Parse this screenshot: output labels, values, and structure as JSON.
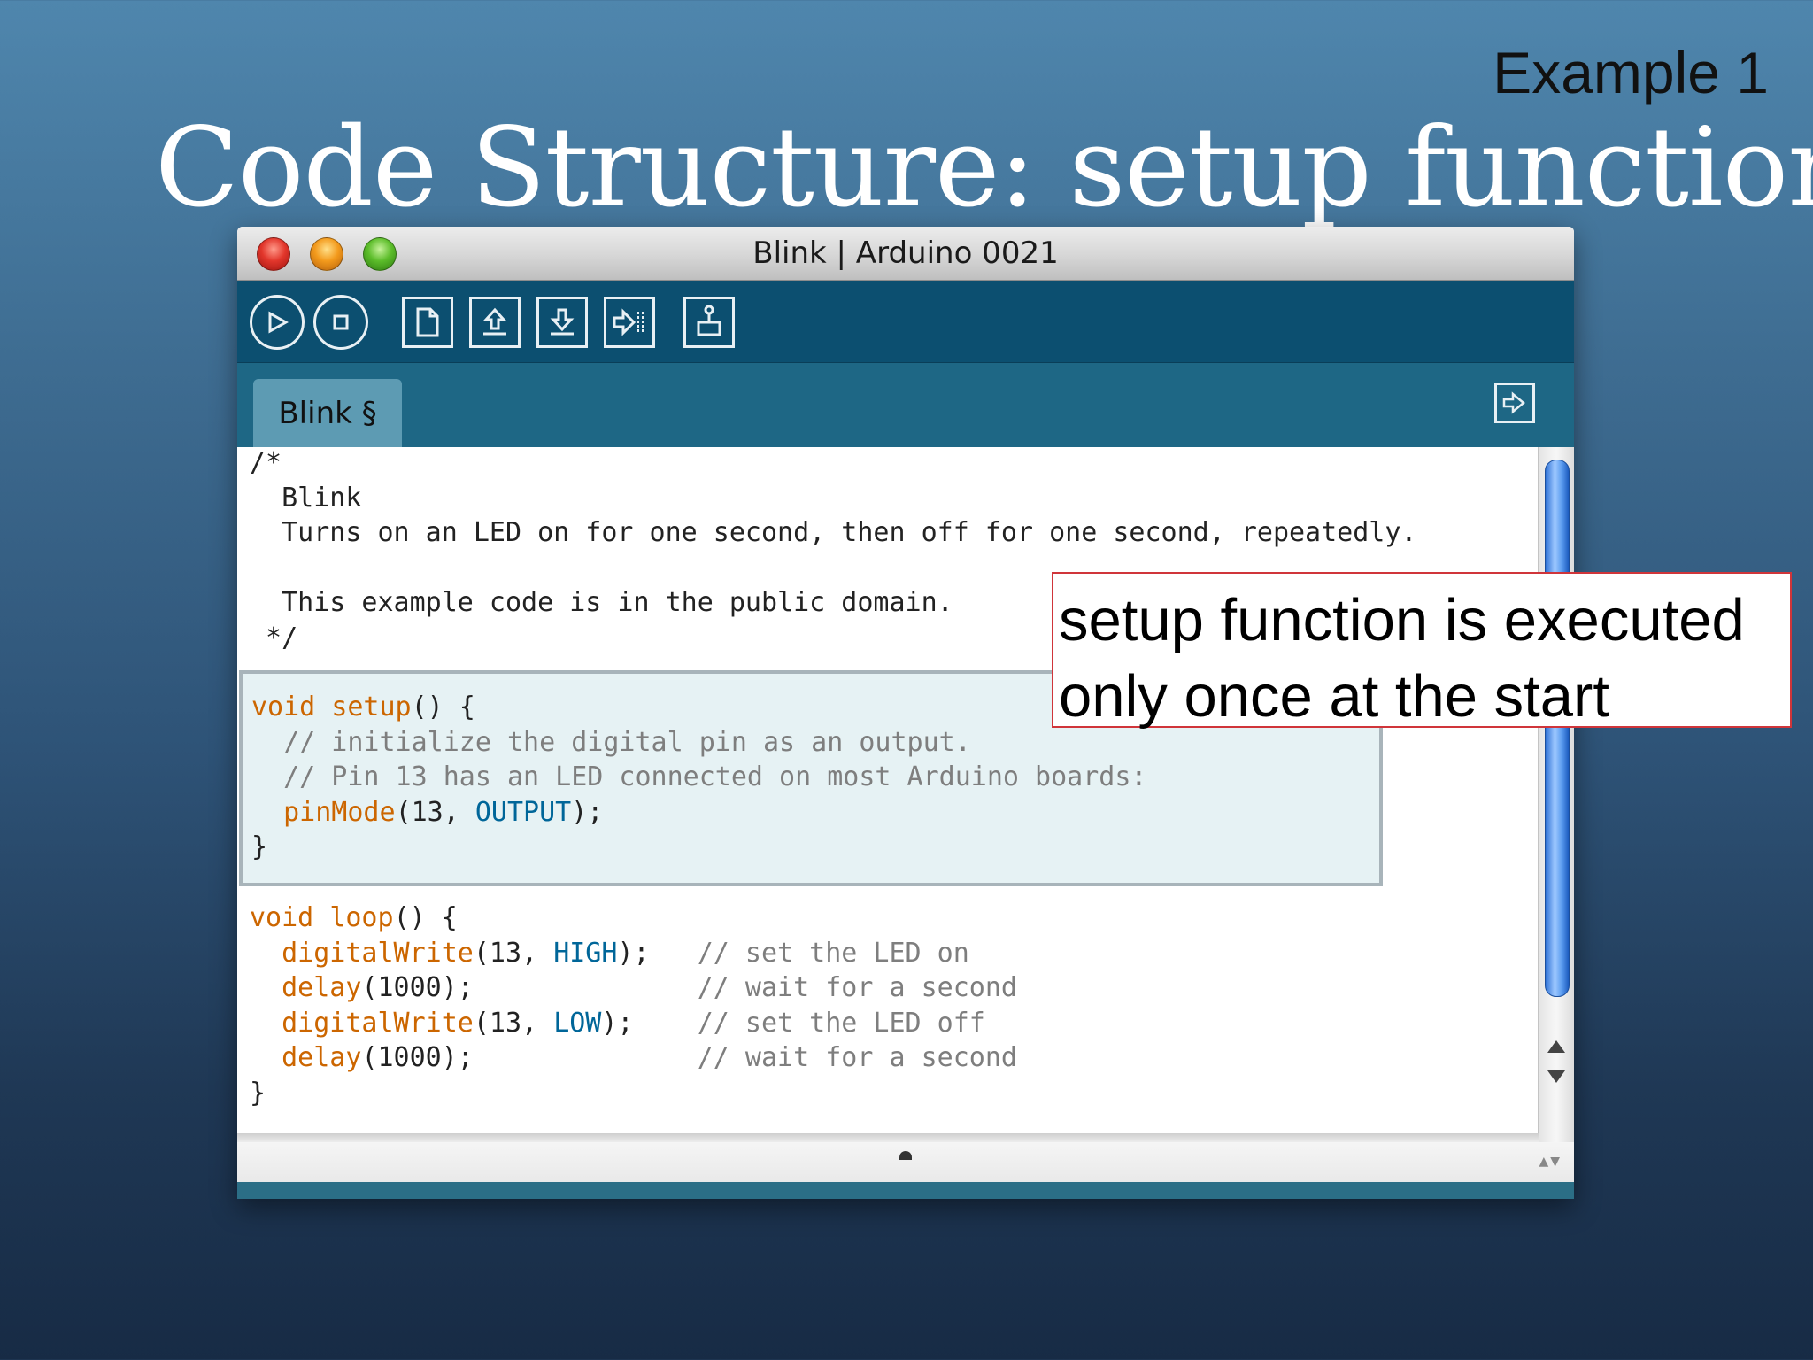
{
  "slide": {
    "example_label": "Example 1",
    "title": "Code Structure: setup function"
  },
  "window": {
    "title": "Blink | Arduino 0021",
    "buttons": {
      "close": "close-icon",
      "minimize": "minimize-icon",
      "maximize": "maximize-icon"
    }
  },
  "toolbar": {
    "icons": [
      "verify-icon",
      "stop-icon",
      "new-icon",
      "open-icon",
      "save-icon",
      "upload-icon",
      "serial-monitor-icon"
    ]
  },
  "tabs": [
    {
      "label": "Blink §"
    }
  ],
  "code": {
    "header": [
      "/*",
      "  Blink",
      "  Turns on an LED on for one second, then off for one second, repeatedly.",
      "",
      "  This example code is in the public domain.",
      " */"
    ],
    "setup": {
      "l1_kw1": "void",
      "l1_sp": " ",
      "l1_kw2": "setup",
      "l1_rest": "() {",
      "l2": "  // initialize the digital pin as an output.",
      "l3": "  // Pin 13 has an LED connected on most Arduino boards:",
      "l4_indent": "  ",
      "l4_fn": "pinMode",
      "l4_args": "(13, ",
      "l4_const": "OUTPUT",
      "l4_end": ");",
      "l5": "}"
    },
    "loop": {
      "l1_kw1": "void",
      "l1_sp": " ",
      "l1_kw2": "loop",
      "l1_rest": "() {",
      "l2_fn": "digitalWrite",
      "l2_args": "(13, ",
      "l2_const": "HIGH",
      "l2_end": ");   ",
      "l2_comment": "// set the LED on",
      "l3_fn": "delay",
      "l3_args": "(1000);              ",
      "l3_comment": "// wait for a second",
      "l4_fn": "digitalWrite",
      "l4_args": "(13, ",
      "l4_const": "LOW",
      "l4_end": ");    ",
      "l4_comment": "// set the LED off",
      "l5_fn": "delay",
      "l5_args": "(1000);              ",
      "l5_comment": "// wait for a second",
      "l6": "}"
    }
  },
  "callout": {
    "line1": "setup function is executed",
    "line2": "only once at the start"
  },
  "colors": {
    "toolbar": "#0c4f70",
    "tabbar": "#1e6785",
    "tab": "#5d9bb3",
    "keyword": "#cc6600",
    "constant": "#006699",
    "comment": "#7e7e7e",
    "callout_border": "#d0353a"
  }
}
